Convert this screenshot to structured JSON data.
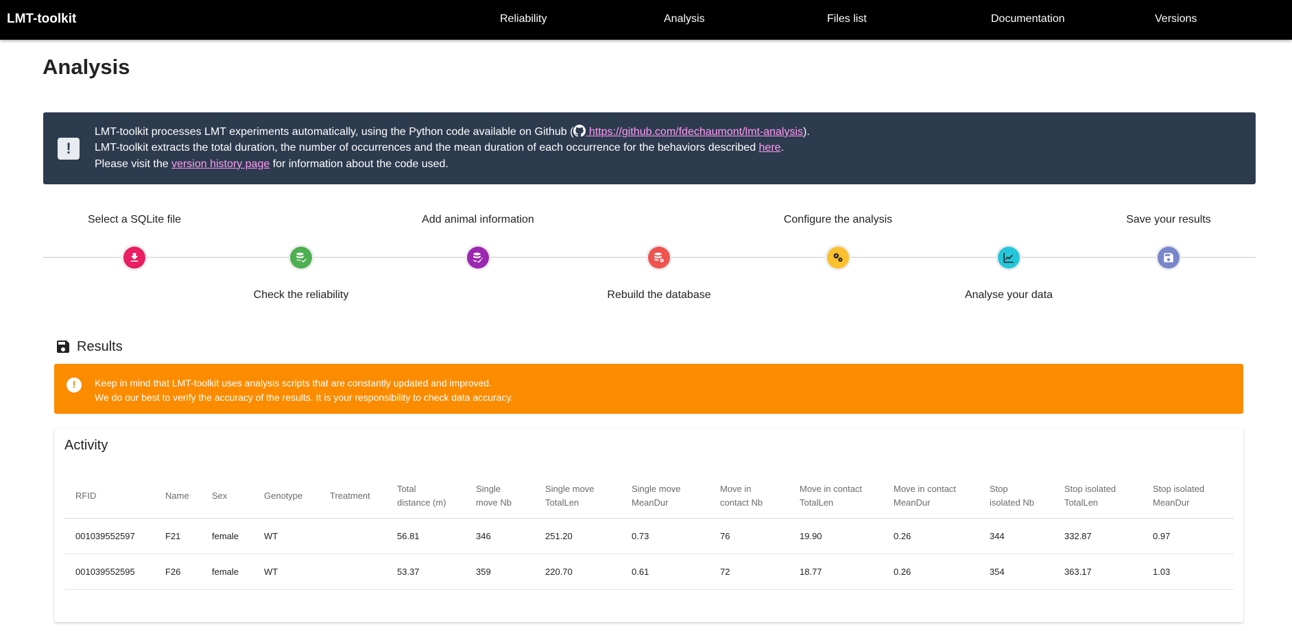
{
  "nav": {
    "brand": "LMT-toolkit",
    "links": [
      "Reliability",
      "Analysis",
      "Files list",
      "Documentation",
      "Versions"
    ]
  },
  "page_title": "Analysis",
  "info": {
    "line1_pre": "LMT-toolkit processes LMT experiments automatically, using the Python code available on Github (",
    "line1_link": " https://github.com/fdechaumont/lmt-analysis",
    "line1_post": ").",
    "line2_pre": "LMT-toolkit extracts the total duration, the number of occurrences and the mean duration of each occurrence for the behaviors described ",
    "line2_link": "here",
    "line2_post": ".",
    "line3_pre": "Please visit the ",
    "line3_link": "version history page",
    "line3_post": " for information about the code used."
  },
  "steps": [
    {
      "label": "Select a SQLite file",
      "position": "top",
      "color": "#e91e63",
      "icon": "download-icon"
    },
    {
      "label": "Check the reliability",
      "position": "bottom",
      "color": "#4caf50",
      "icon": "database-check-icon"
    },
    {
      "label": "Add animal information",
      "position": "top",
      "color": "#9c27b0",
      "icon": "database-edit-icon"
    },
    {
      "label": "Rebuild the database",
      "position": "bottom",
      "color": "#ef5350",
      "icon": "database-gear-icon"
    },
    {
      "label": "Configure the analysis",
      "position": "top",
      "color": "#fbc02d",
      "icon": "gears-icon"
    },
    {
      "label": "Analyse your data",
      "position": "bottom",
      "color": "#26c6da",
      "icon": "chart-line-icon"
    },
    {
      "label": "Save your results",
      "position": "top",
      "color": "#7986cb",
      "icon": "save-icon"
    }
  ],
  "results": {
    "title": "Results",
    "warning_line1": "Keep in mind that LMT-toolkit uses analysis scripts that are constantly updated and improved.",
    "warning_line2": "We do our best to verify the accuracy of the results. It is your responsibility to check data accuracy."
  },
  "activity": {
    "title": "Activity",
    "columns": [
      [
        "RFID"
      ],
      [
        "Name"
      ],
      [
        "Sex"
      ],
      [
        "Genotype"
      ],
      [
        "Treatment"
      ],
      [
        "Total",
        "distance (m)"
      ],
      [
        "Single",
        "move Nb"
      ],
      [
        "Single move",
        "TotalLen"
      ],
      [
        "Single move",
        "MeanDur"
      ],
      [
        "Move in",
        "contact Nb"
      ],
      [
        "Move in contact",
        "TotalLen"
      ],
      [
        "Move in contact",
        "MeanDur"
      ],
      [
        "Stop",
        "isolated Nb"
      ],
      [
        "Stop isolated",
        "TotalLen"
      ],
      [
        "Stop isolated",
        "MeanDur"
      ]
    ],
    "rows": [
      [
        "001039552597",
        "F21",
        "female",
        "WT",
        "",
        "56.81",
        "346",
        "251.20",
        "0.73",
        "76",
        "19.90",
        "0.26",
        "344",
        "332.87",
        "0.97"
      ],
      [
        "001039552595",
        "F26",
        "female",
        "WT",
        "",
        "53.37",
        "359",
        "220.70",
        "0.61",
        "72",
        "18.77",
        "0.26",
        "354",
        "363.17",
        "1.03"
      ]
    ]
  }
}
